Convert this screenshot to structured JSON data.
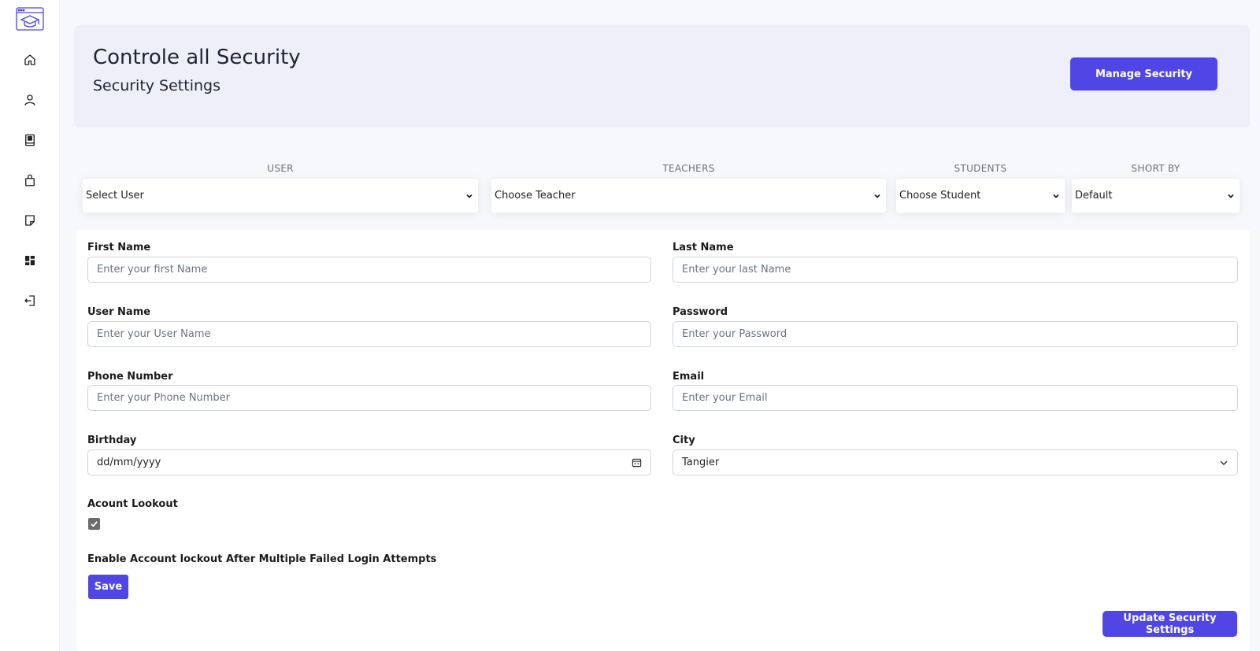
{
  "colors": {
    "accent": "#4f46e5",
    "header_bg": "#efeffa",
    "page_bg": "#f7f8fb"
  },
  "sidebar": {
    "logo_icon": "graduation-cap-window-icon",
    "items": [
      {
        "icon": "home-icon"
      },
      {
        "icon": "user-icon"
      },
      {
        "icon": "book-icon"
      },
      {
        "icon": "shopping-bag-icon"
      },
      {
        "icon": "sticky-note-icon"
      },
      {
        "icon": "dashboard-icon"
      },
      {
        "icon": "logout-icon"
      }
    ]
  },
  "header": {
    "title": "Controle all Security",
    "subtitle": "Security Settings",
    "manage_button": "Manage Security"
  },
  "filters": [
    {
      "label": "USER",
      "value": "Select User"
    },
    {
      "label": "TEACHERS",
      "value": "Choose Teacher"
    },
    {
      "label": "STUDENTS",
      "value": "Choose Student"
    },
    {
      "label": "SHORT BY",
      "value": "Default"
    }
  ],
  "form": {
    "first_name": {
      "label": "First Name",
      "placeholder": "Enter your first Name"
    },
    "last_name": {
      "label": "Last Name",
      "placeholder": "Enter your last Name"
    },
    "user_name": {
      "label": "User Name",
      "placeholder": "Enter your User Name"
    },
    "password": {
      "label": "Password",
      "placeholder": "Enter your Password"
    },
    "phone": {
      "label": "Phone Number",
      "placeholder": "Enter your Phone Number"
    },
    "email": {
      "label": "Email",
      "placeholder": "Enter your Email"
    },
    "birthday": {
      "label": "Birthday",
      "value": "dd/mm/yyyy"
    },
    "city": {
      "label": "City",
      "value": "Tangier"
    },
    "lookout": {
      "label": "Acount Lookout",
      "checked": true
    },
    "lockout_text": "Enable Account lockout After Multiple Failed Login Attempts",
    "save_button": "Save",
    "update_button": "Update Security Settings"
  }
}
